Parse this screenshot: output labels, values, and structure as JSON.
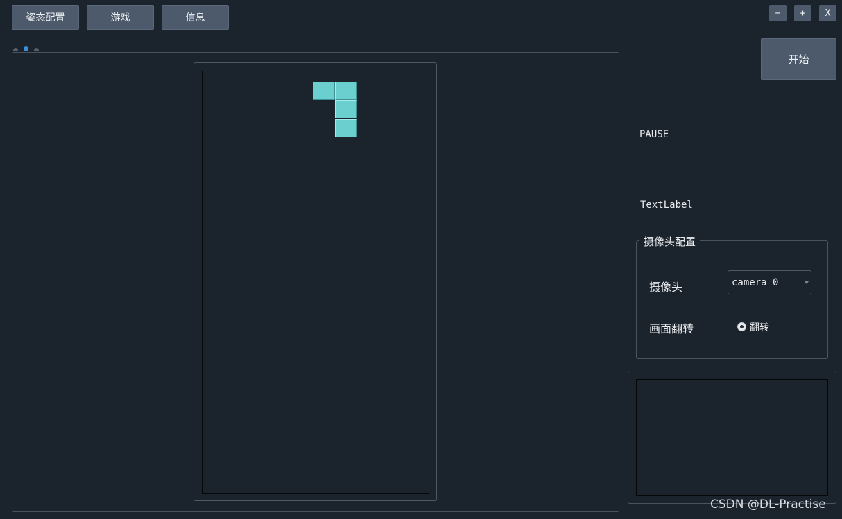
{
  "tabs": [
    {
      "label": "姿态配置"
    },
    {
      "label": "游戏"
    },
    {
      "label": "信息"
    }
  ],
  "window_controls": {
    "minimize": "−",
    "maximize": "+",
    "close": "X"
  },
  "start_button": "开始",
  "status_label": "PAUSE",
  "text_label": "TextLabel",
  "camera_config": {
    "title": "摄像头配置",
    "camera_label": "摄像头",
    "camera_value": "camera 0",
    "flip_label": "画面翻转",
    "flip_option": "翻转",
    "flip_checked": true
  },
  "watermark": "CSDN @DL-Practise",
  "colors": {
    "background": "#1b232c",
    "button": "#4d5a6b",
    "piece": "#6ccfcf",
    "active_tab_dot": "#3c8ed6"
  }
}
